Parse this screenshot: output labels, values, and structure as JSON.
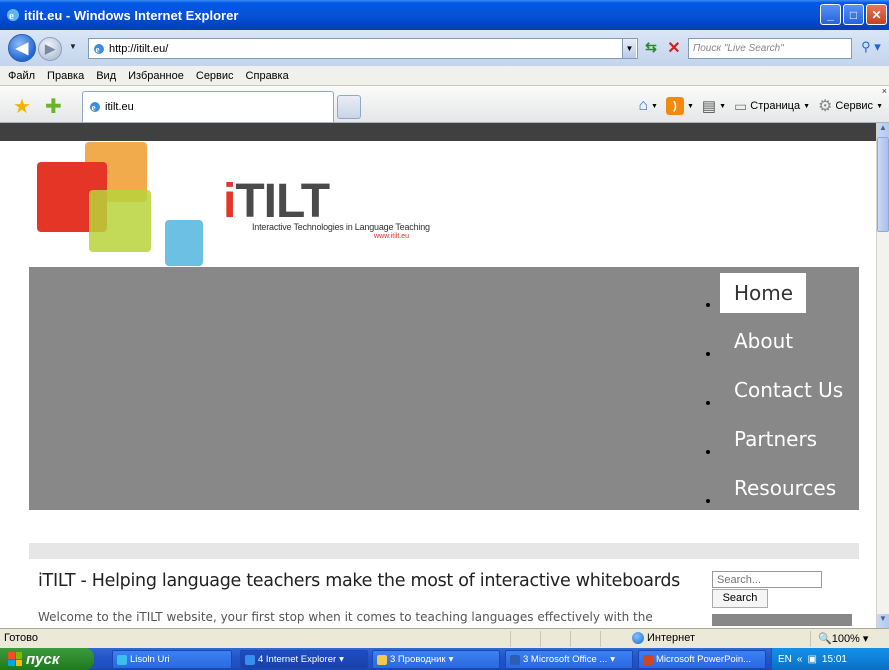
{
  "window": {
    "title": "itilt.eu - Windows Internet Explorer",
    "buttons": {
      "minimize": "_",
      "maximize": "□",
      "close": "✕"
    }
  },
  "address_bar": {
    "url": "http://itilt.eu/",
    "search_placeholder": "Поиск \"Live Search\""
  },
  "menu": {
    "items": [
      "Файл",
      "Правка",
      "Вид",
      "Избранное",
      "Сервис",
      "Справка"
    ]
  },
  "tabs": [
    {
      "label": "itilt.eu"
    }
  ],
  "command_bar": {
    "page_label": "Страница",
    "tools_label": "Сервис"
  },
  "page": {
    "logo": {
      "name_i": "i",
      "name_rest": "TILT",
      "subtitle": "Interactive Technologies in Language Teaching",
      "url": "www.itilt.eu"
    },
    "nav": [
      {
        "label": "Home",
        "active": true
      },
      {
        "label": "About",
        "active": false
      },
      {
        "label": "Contact Us",
        "active": false
      },
      {
        "label": "Partners",
        "active": false
      },
      {
        "label": "Resources",
        "active": false
      }
    ],
    "headline": "iTILT - Helping language teachers make the most of interactive whiteboards",
    "welcome": "Welcome to the iTILT website, your first stop when it comes to teaching languages effectively with the",
    "sidebar": {
      "search_placeholder": "Search...",
      "search_button": "Search"
    }
  },
  "status_bar": {
    "text": "Готово",
    "zone": "Интернет",
    "zoom": "100%"
  },
  "taskbar": {
    "start_label": "пуск",
    "tasks": [
      {
        "label": "Lisoln Uri",
        "color": "#3ac0f0"
      },
      {
        "label": "4 Internet Explorer",
        "color": "#3a8df0",
        "active": true
      },
      {
        "label": "3 Проводник",
        "color": "#f2c94c"
      },
      {
        "label": "3 Microsoft Office ...",
        "color": "#2b5fb4"
      },
      {
        "label": "Microsoft PowerPoin...",
        "color": "#d2451e"
      }
    ],
    "tray": {
      "lang": "EN",
      "time": "15:01"
    }
  }
}
